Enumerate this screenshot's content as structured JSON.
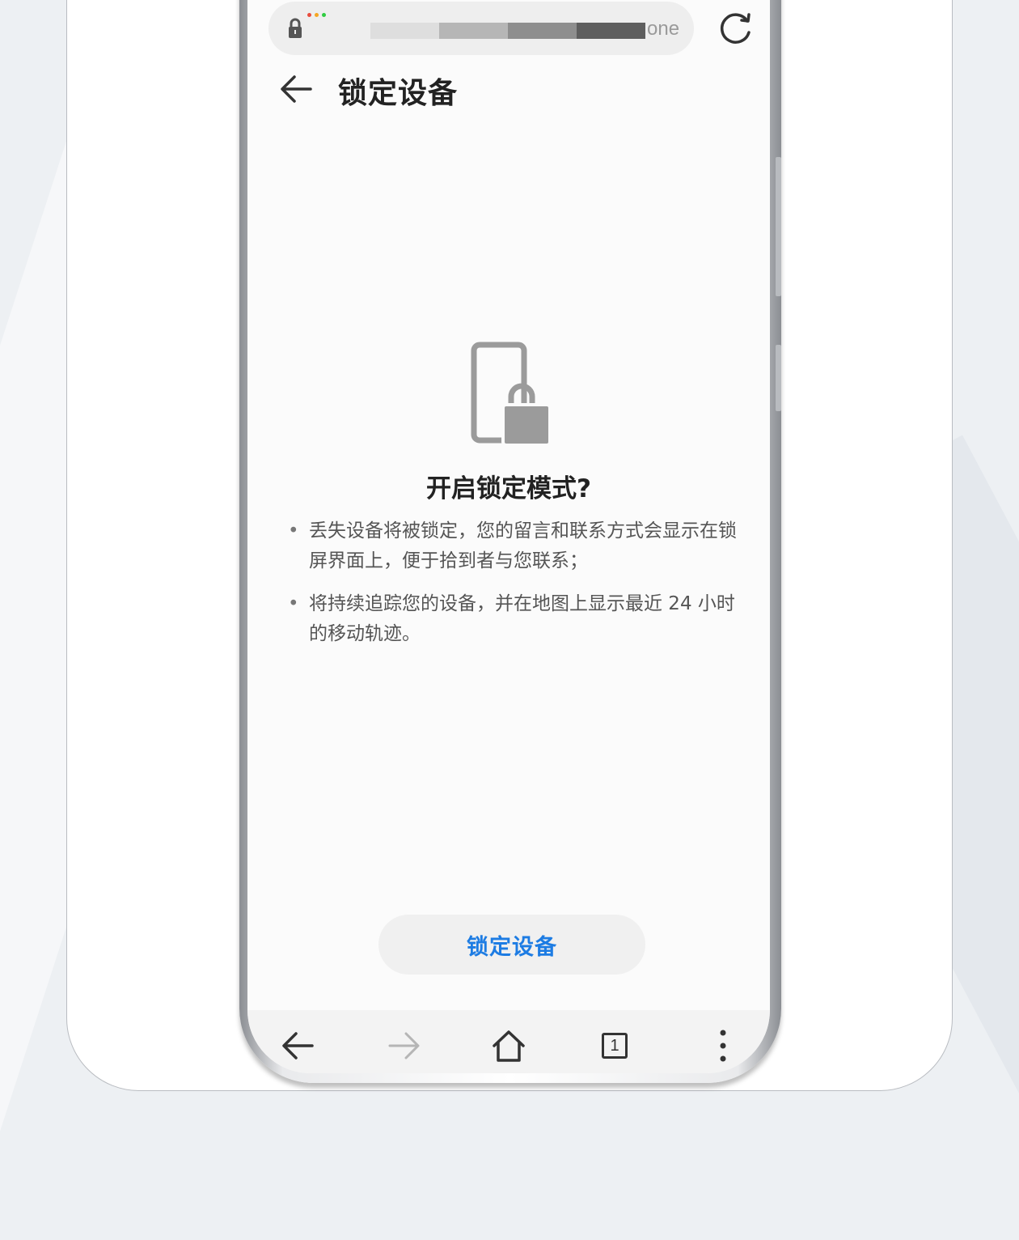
{
  "url_bar": {
    "url_text": "",
    "url_tail": "one",
    "dot_colors": [
      "#e84c3d",
      "#f5a623",
      "#2ecc40"
    ]
  },
  "header": {
    "title": "锁定设备"
  },
  "dialog": {
    "title": "开启锁定模式?",
    "bullets": [
      "丢失设备将被锁定，您的留言和联系方式会显示在锁屏界面上，便于拾到者与您联系；",
      "将持续追踪您的设备，并在地图上显示最近 24 小时的移动轨迹。"
    ],
    "button_label": "锁定设备"
  },
  "bottom_nav": {
    "tab_count": "1"
  },
  "colors": {
    "accent": "#1d7ce3",
    "icon_gray": "#9b9b9b"
  }
}
